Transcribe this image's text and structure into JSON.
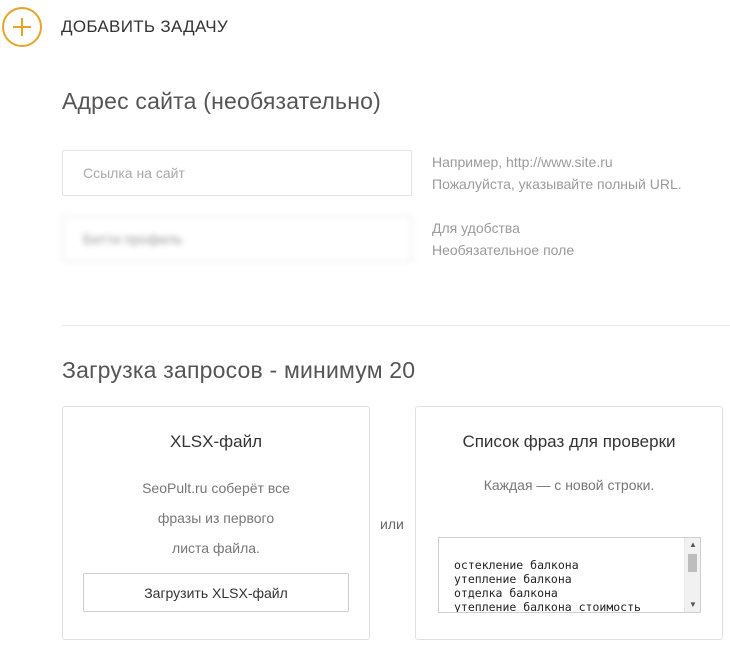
{
  "header": {
    "add_icon": "plus-circle-icon",
    "title": "ДОБАВИТЬ ЗАДАЧУ",
    "accent_color": "#e5a526"
  },
  "site_section": {
    "title": "Адрес сайта (необязательно)",
    "url_field": {
      "placeholder": "Ссылка на сайт",
      "value": "",
      "hint_line1": "Например, http://www.site.ru",
      "hint_line2": "Пожалуйста, указывайте полный URL."
    },
    "profile_field": {
      "placeholder": "",
      "value": "Битти профиль",
      "hint_line1": "Для удобства",
      "hint_line2": "Необязательное поле"
    }
  },
  "upload_section": {
    "title": "Загрузка запросов - минимум 20",
    "xlsx_card": {
      "title": "XLSX-файл",
      "desc_line1": "SeoPult.ru соберёт все",
      "desc_line2": "фразы из первого",
      "desc_line3": "листа файла.",
      "button_label": "Загрузить XLSX-файл"
    },
    "or_label": "или",
    "list_card": {
      "title": "Список фраз для проверки",
      "desc": "Каждая — с новой строки.",
      "phrases": "остекление балкона\nутепление балкона\nотделка балкона\nутепление балкона стоимость",
      "scroll_up_icon": "triangle-up-icon",
      "scroll_down_icon": "triangle-down-icon"
    }
  }
}
